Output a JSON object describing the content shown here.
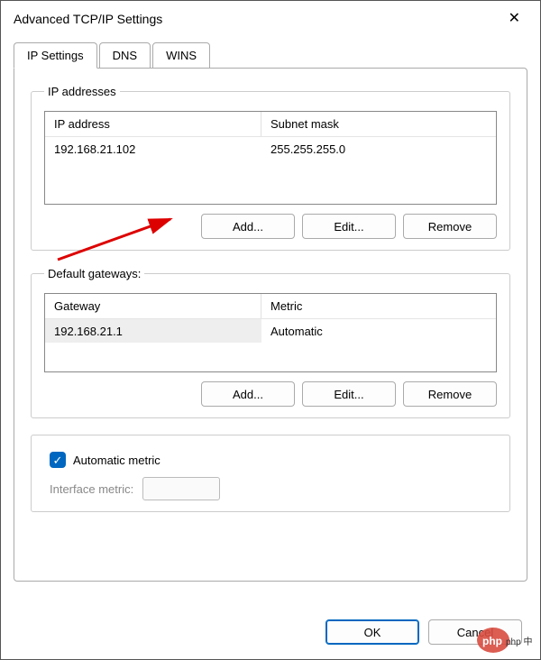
{
  "window": {
    "title": "Advanced TCP/IP Settings"
  },
  "tabs": {
    "ip_settings": "IP Settings",
    "dns": "DNS",
    "wins": "WINS"
  },
  "ip_addresses": {
    "legend": "IP addresses",
    "col_ip": "IP address",
    "col_mask": "Subnet mask",
    "rows": [
      {
        "ip": "192.168.21.102",
        "mask": "255.255.255.0"
      }
    ],
    "add": "Add...",
    "edit": "Edit...",
    "remove": "Remove"
  },
  "gateways": {
    "legend": "Default gateways:",
    "col_gw": "Gateway",
    "col_metric": "Metric",
    "rows": [
      {
        "gw": "192.168.21.1",
        "metric": "Automatic"
      }
    ],
    "add": "Add...",
    "edit": "Edit...",
    "remove": "Remove"
  },
  "metric": {
    "auto_label": "Automatic metric",
    "checked": true,
    "interface_label": "Interface metric:",
    "interface_value": ""
  },
  "footer": {
    "ok": "OK",
    "cancel": "Cancel"
  },
  "watermark": "php 中文网"
}
